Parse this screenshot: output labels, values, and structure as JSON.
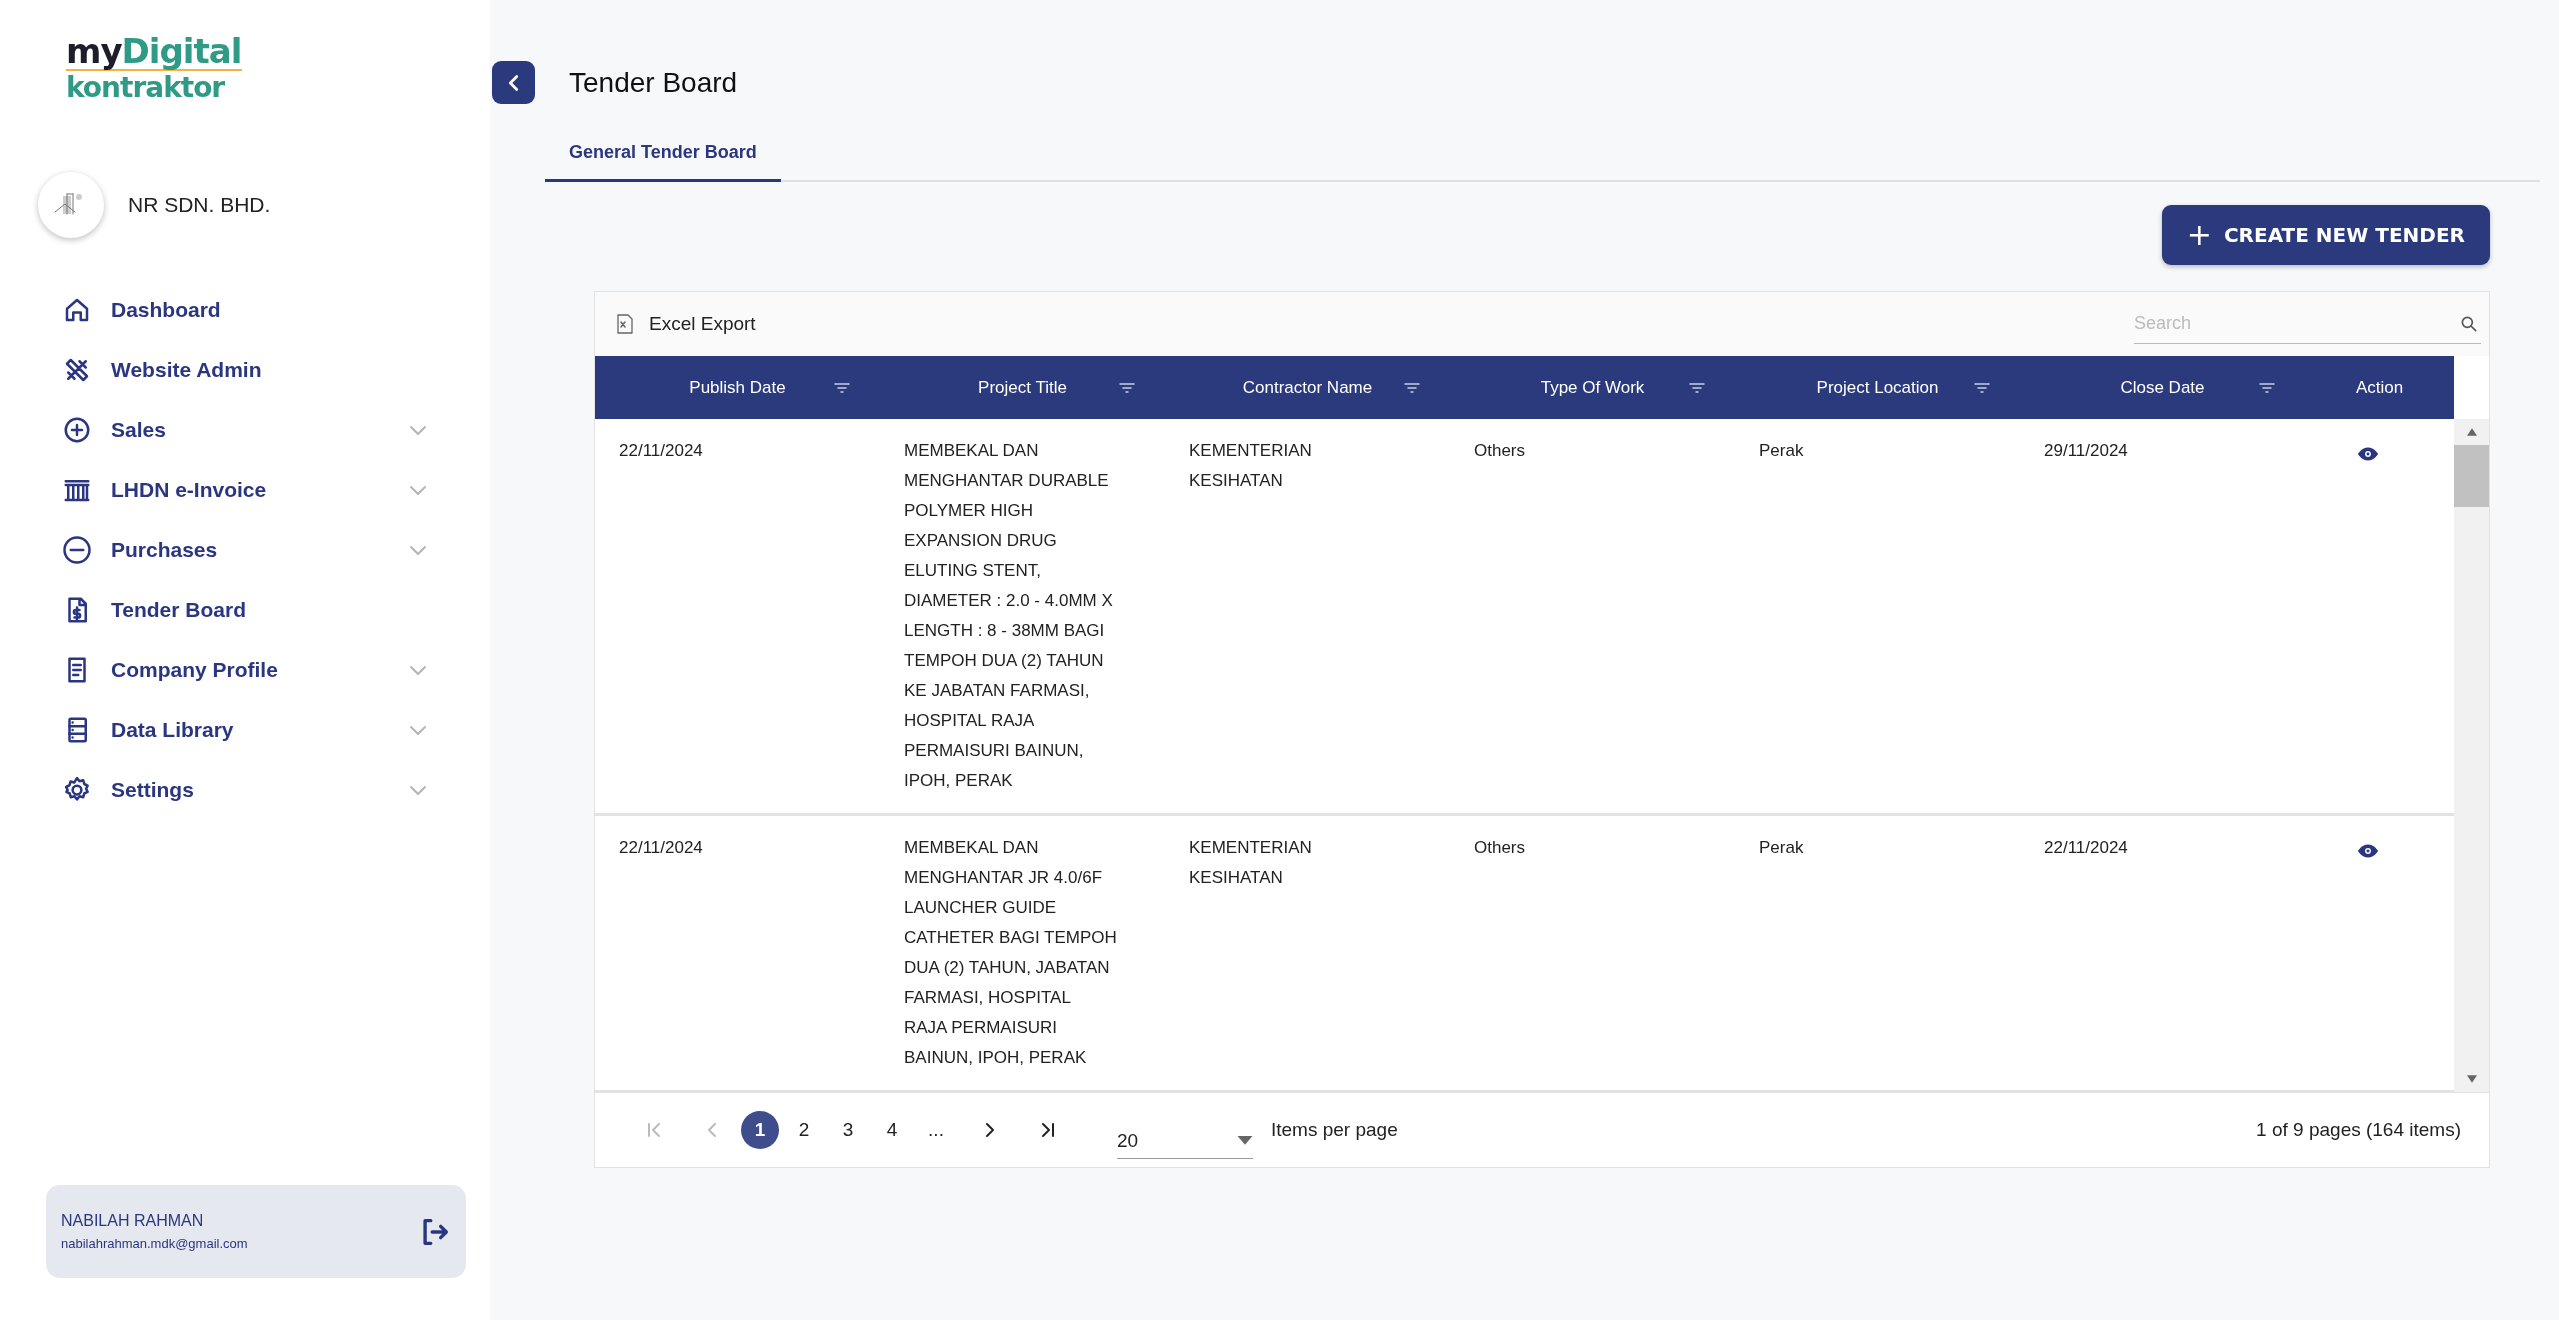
{
  "sidebar": {
    "logo": {
      "part_1": "my",
      "part_2": "Digital",
      "part_3": "kontraktor"
    },
    "company": {
      "name": "NR SDN. BHD."
    },
    "items": [
      {
        "label": "Dashboard",
        "expandable": false
      },
      {
        "label": "Website Admin",
        "expandable": false
      },
      {
        "label": "Sales",
        "expandable": true
      },
      {
        "label": "LHDN e-Invoice",
        "expandable": true
      },
      {
        "label": "Purchases",
        "expandable": true
      },
      {
        "label": "Tender Board",
        "expandable": false
      },
      {
        "label": "Company Profile",
        "expandable": true
      },
      {
        "label": "Data Library",
        "expandable": true
      },
      {
        "label": "Settings",
        "expandable": true
      }
    ],
    "user": {
      "name": "NABILAH RAHMAN",
      "email": "nabilahrahman.mdk@gmail.com"
    }
  },
  "page": {
    "title": "Tender Board"
  },
  "tabs": [
    {
      "label": "General Tender Board",
      "selected": true
    }
  ],
  "create_button": {
    "label": "CREATE NEW TENDER",
    "icon": "+"
  },
  "toolbar": {
    "export_label": "Excel Export",
    "search": {
      "placeholder": "Search"
    }
  },
  "table": {
    "columns": [
      {
        "label": "Publish Date",
        "filter": true
      },
      {
        "label": "Project Title",
        "filter": true
      },
      {
        "label": "Contractor Name",
        "filter": true
      },
      {
        "label": "Type Of Work",
        "filter": true
      },
      {
        "label": "Project Location",
        "filter": true
      },
      {
        "label": "Close Date",
        "filter": true
      },
      {
        "label": "Action",
        "filter": false
      }
    ],
    "rows": [
      {
        "cells": [
          "22/11/2024",
          "MEMBEKAL DAN MENGHANTAR DURABLE POLYMER HIGH EXPANSION DRUG ELUTING STENT, DIAMETER : 2.0 - 4.0MM X LENGTH : 8 - 38MM BAGI TEMPOH DUA (2) TAHUN KE JABATAN FARMASI, HOSPITAL RAJA PERMAISURI BAINUN, IPOH, PERAK",
          "KEMENTERIAN KESIHATAN",
          "Others",
          "Perak",
          "29/11/2024"
        ]
      },
      {
        "cells": [
          "22/11/2024",
          "MEMBEKAL DAN MENGHANTAR JR 4.0/6F LAUNCHER GUIDE CATHETER BAGI TEMPOH DUA (2) TAHUN, JABATAN FARMASI, HOSPITAL RAJA PERMAISURI BAINUN, IPOH, PERAK",
          "KEMENTERIAN KESIHATAN",
          "Others",
          "Perak",
          "22/11/2024"
        ]
      }
    ]
  },
  "pagination": {
    "pages": [
      {
        "label": "1",
        "selected": true
      },
      {
        "label": "2",
        "selected": false
      },
      {
        "label": "3",
        "selected": false
      },
      {
        "label": "4",
        "selected": false
      },
      {
        "label": "...",
        "selected": false
      }
    ],
    "page_size": "20",
    "page_size_label": "Items per page",
    "summary": "1 of 9 pages (164 items)"
  }
}
